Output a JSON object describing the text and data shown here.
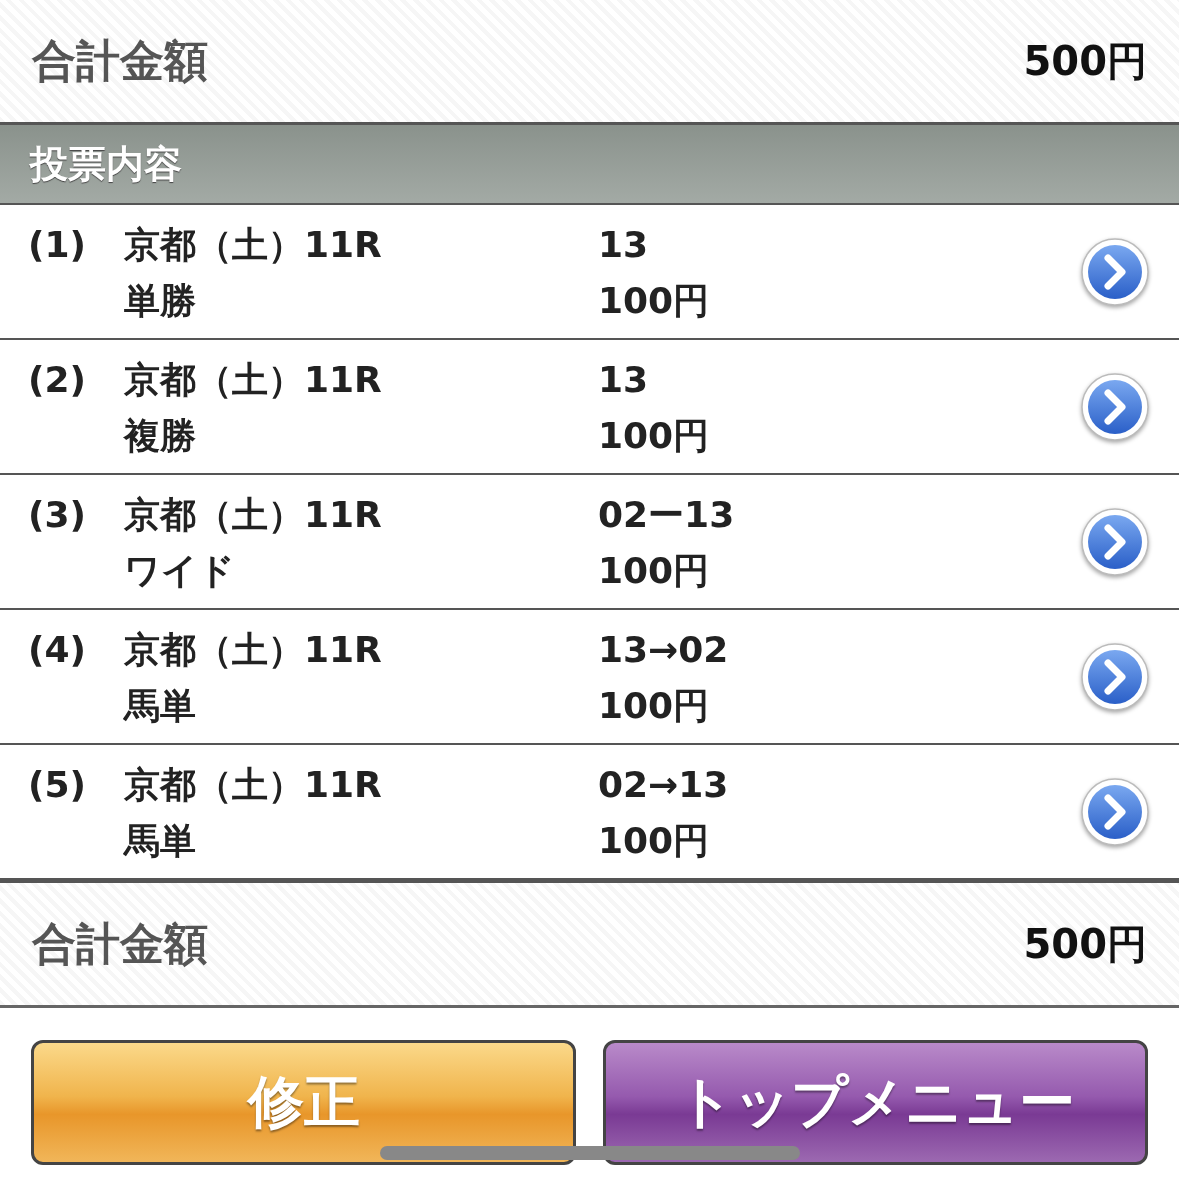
{
  "summary_top": {
    "label": "合計金額",
    "amount": "500円"
  },
  "section_title": "投票内容",
  "bets": [
    {
      "number": "(1)",
      "race": "京都（土）11R",
      "bet_type": "単勝",
      "selection": "13",
      "amount": "100円"
    },
    {
      "number": "(2)",
      "race": "京都（土）11R",
      "bet_type": "複勝",
      "selection": "13",
      "amount": "100円"
    },
    {
      "number": "(3)",
      "race": "京都（土）11R",
      "bet_type": "ワイド",
      "selection": "02ー13",
      "amount": "100円"
    },
    {
      "number": "(4)",
      "race": "京都（土）11R",
      "bet_type": "馬単",
      "selection": "13→02",
      "amount": "100円"
    },
    {
      "number": "(5)",
      "race": "京都（土）11R",
      "bet_type": "馬単",
      "selection": "02→13",
      "amount": "100円"
    }
  ],
  "summary_bottom": {
    "label": "合計金額",
    "amount": "500円"
  },
  "buttons": [
    {
      "label": "修正",
      "kind": "orange"
    },
    {
      "label": "トップメニュー",
      "kind": "purple"
    }
  ]
}
